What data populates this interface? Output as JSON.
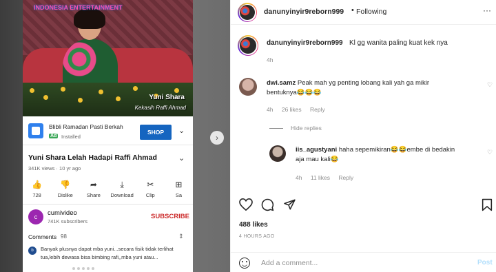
{
  "left_panel": {
    "video": {
      "watermark": "INDONESIA ENTERTAINMENT",
      "caption_name": "Yuni Shara",
      "caption_sub": "Kekasih Raffi Ahmad"
    },
    "ad": {
      "title": "Blibli Ramadan Pasti Berkah",
      "badge": "Ad",
      "status": "Installed",
      "cta": "SHOP"
    },
    "video_title": "Yuni Shara Lelah Hadapi Raffi Ahmad",
    "video_meta": "341K views · 10 yr ago",
    "actions": [
      {
        "icon": "👍",
        "label": "728"
      },
      {
        "icon": "👎",
        "label": "Dislike"
      },
      {
        "icon": "➦",
        "label": "Share"
      },
      {
        "icon": "⤓",
        "label": "Download"
      },
      {
        "icon": "✂",
        "label": "Clip"
      },
      {
        "icon": "⊞",
        "label": "Sa"
      }
    ],
    "channel": {
      "initial": "c",
      "name": "cumivideo",
      "subs": "741K subscribers",
      "subscribe": "SUBSCRIBE"
    },
    "comments": {
      "header": "Comments",
      "count": "98",
      "first_initial": "b",
      "first_text": "Banyak plusnya dapat mba yuni...secara fisik tidak terlihat tua,lebih dewasa bisa bimbing rafi,,mba yuni atau..."
    }
  },
  "instagram": {
    "header": {
      "username": "danunyinyir9reborn999",
      "dot": "•",
      "following": "Following",
      "more": "···"
    },
    "caption": {
      "username": "danunyinyir9reborn999",
      "text": "Kl gg wanita paling kuat kek nya",
      "time": "4h"
    },
    "comments": [
      {
        "username": "dwi.samz",
        "text_line1": "Peak mah yg penting lobang kali yah ga mikir",
        "text_line2": "bentuknya😂😂😂",
        "time": "4h",
        "likes": "26 likes",
        "reply": "Reply"
      },
      {
        "username": "iis_agustyani",
        "text_line1": "haha sepemikiran😂😂embe di bedakin",
        "text_line2": "aja mau kali😂",
        "time": "4h",
        "likes": "11 likes",
        "reply": "Reply"
      }
    ],
    "hide_replies": "Hide replies",
    "likes": "488 likes",
    "time_ago": "4 HOURS AGO",
    "add_comment_placeholder": "Add a comment...",
    "post_label": "Post",
    "icons": {
      "like": "heart-icon",
      "comment": "comment-icon",
      "share": "share-icon",
      "save": "bookmark-icon"
    }
  }
}
